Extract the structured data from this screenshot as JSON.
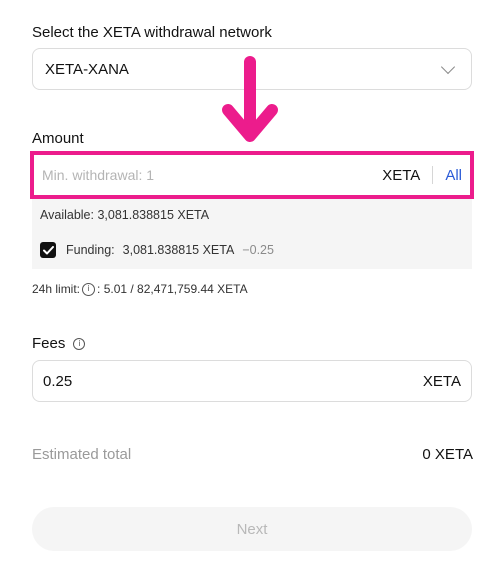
{
  "network": {
    "label": "Select the XETA withdrawal network",
    "selected": "XETA-XANA"
  },
  "amount": {
    "label": "Amount",
    "placeholder": "Min. withdrawal: 1",
    "unit": "XETA",
    "all_label": "All",
    "available": "Available: 3,081.838815 XETA",
    "funding_label": "Funding:",
    "funding_value": "3,081.838815 XETA",
    "funding_fee": "−0.25",
    "funding_checked": true,
    "limit_prefix": "24h limit:",
    "limit_value": ": 5.01 / 82,471,759.44 XETA"
  },
  "fees": {
    "label": "Fees",
    "value": "0.25",
    "unit": "XETA"
  },
  "total": {
    "label": "Estimated total",
    "value": "0 XETA"
  },
  "actions": {
    "next_label": "Next"
  },
  "annotation": {
    "color": "#ec1c8c",
    "arrow_icon": "arrow-down-icon"
  }
}
